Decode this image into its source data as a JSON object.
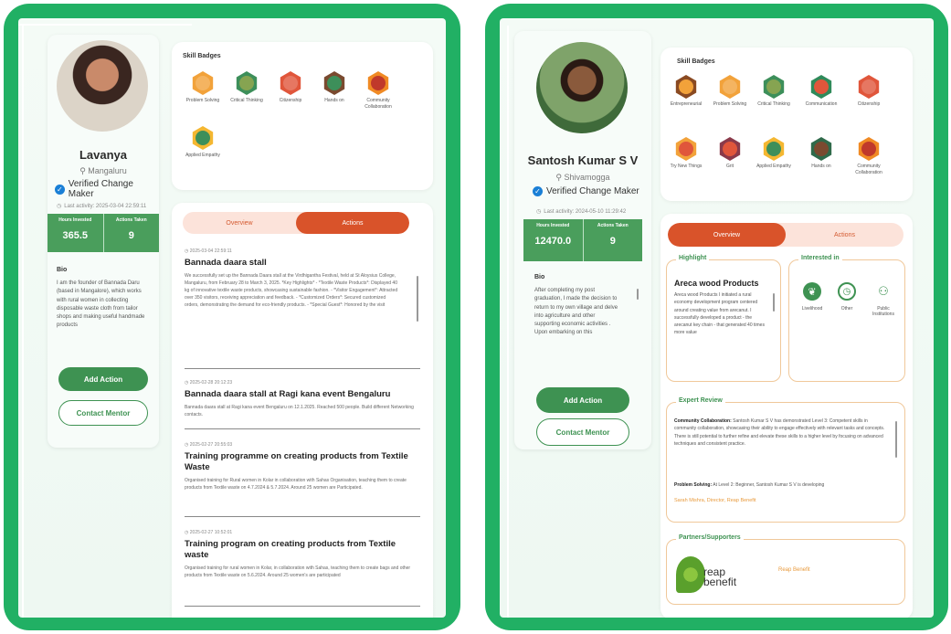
{
  "left": {
    "name": "Lavanya",
    "location": "Mangaluru",
    "verified_label": "Verified Change Maker",
    "last_activity": "Last activity: 2025-03-04 22:59:11",
    "stats": [
      {
        "label": "Hours Invested",
        "value": "365.5"
      },
      {
        "label": "Actions Taken",
        "value": "9"
      }
    ],
    "bio_title": "Bio",
    "bio_text": "I am the founder of Bannada Daru (based in Mangalore), which works with rural women in collecting disposable waste cloth from tailor shops and making useful handmade products",
    "add_action": "Add Action",
    "contact_mentor": "Contact Mentor",
    "skill_badges_title": "Skill Badges",
    "badges": [
      {
        "label": "Problem Solving",
        "color": "#f2a23a",
        "icon": "puzzle-icon"
      },
      {
        "label": "Critical Thinking",
        "color": "#3d8f5a",
        "icon": "lightbulb-icon"
      },
      {
        "label": "Citizenship",
        "color": "#e0563b",
        "icon": "flag-icon"
      },
      {
        "label": "Hands on",
        "color": "#7a4a2f",
        "icon": "hand-icon"
      },
      {
        "label": "Community Collaboration",
        "color": "#f08a24",
        "icon": "handshake-icon"
      },
      {
        "label": "Applied Empathy",
        "color": "#f4b731",
        "icon": "heart-hands-icon"
      }
    ],
    "tabs": [
      {
        "label": "Overview"
      },
      {
        "label": "Actions"
      }
    ],
    "actions": [
      {
        "date": "2025-03-04 22:59:11",
        "title": "Bannada daara stall",
        "desc": "We successfully set up the Bannada Daara stall at the Virdhigantha Festival, held at St Aloysius College, Mangaluru, from February 28 to March 3, 2025. *Key Highlights* - *Textile Waste Products*: Displayed 40 kg of innovative textile waste products, showcasing sustainable fashion. - *Visitor Engagement*: Attracted over 350 visitors, receiving appreciation and feedback. - *Customized Orders*: Secured customized orders, demonstrating the demand for eco-friendly products. - *Special Guest*: Honored by the visit"
      },
      {
        "date": "2025-02-28 20:12:23",
        "title": "Bannada daara stall at Ragi kana event Bengaluru",
        "desc": "Bannada daara stall at Ragi kana event Bengaluru on 12.1.2025. Reached 500 people. Build different Networking contacts."
      },
      {
        "date": "2025-02-27 20:55:03",
        "title": "Training programme on creating products from Textile Waste",
        "desc": "Organised training for Rural women in Kolar in collaboration with Sahas Organisation, teaching them to create products from Textile waste on 4.7.2024 & 5.7.2024. Around 25 women are Participated."
      },
      {
        "date": "2025-02-27 10:52:01",
        "title": "Training program on creating products from Textile waste",
        "desc": "Organised training for rural women in Kolar, in collaboration with Sahas, teaching them to create bags and other products from Textile waste on 5.6.2024. Around 25 women's are participated"
      }
    ]
  },
  "right": {
    "name": "Santosh Kumar S V",
    "location": "Shivamogga",
    "verified_label": "Verified Change Maker",
    "last_activity": "Last activity: 2024-05-10 11:29:42",
    "stats": [
      {
        "label": "Hours Invested",
        "value": "12470.0"
      },
      {
        "label": "Actions Taken",
        "value": "9"
      }
    ],
    "bio_title": "Bio",
    "bio_text": "After completing my post graduation, I made the decision to return to my own village and delve into agriculture and other supporting economic activities . Upon embarking on this",
    "add_action": "Add Action",
    "contact_mentor": "Contact Mentor",
    "skill_badges_title": "Skill Badges",
    "badges": [
      {
        "label": "Entrepreneurial",
        "color": "#8a4a22",
        "icon": "gear-icon"
      },
      {
        "label": "Problem Solving",
        "color": "#f2a23a",
        "icon": "puzzle-icon"
      },
      {
        "label": "Critical Thinking",
        "color": "#3d8f5a",
        "icon": "lightbulb-icon"
      },
      {
        "label": "Communication",
        "color": "#2f8a5a",
        "icon": "chat-icon"
      },
      {
        "label": "Citizenship",
        "color": "#e0563b",
        "icon": "flag-icon"
      },
      {
        "label": "Try New Things",
        "color": "#f2a23a",
        "icon": "sparkle-icon"
      },
      {
        "label": "Grit",
        "color": "#8a3a4a",
        "icon": "fist-icon"
      },
      {
        "label": "Applied Empathy",
        "color": "#f4b731",
        "icon": "heart-hands-icon"
      },
      {
        "label": "Hands on",
        "color": "#2f6a4a",
        "icon": "hand-icon"
      },
      {
        "label": "Community Collaboration",
        "color": "#f08a24",
        "icon": "handshake-icon"
      }
    ],
    "tabs": [
      {
        "label": "Overview"
      },
      {
        "label": "Actions"
      }
    ],
    "highlight": {
      "legend": "Highlight",
      "title": "Areca wood Products",
      "text": "Areca wood Products I initiated a rural economy development program centered around creating value from arecanut. I successfully developed a product - the arecanut key chain - that generated 40 times more value"
    },
    "interested": {
      "legend": "Interested in",
      "items": [
        {
          "label": "Livelihood",
          "icon": "leaf-icon"
        },
        {
          "label": "Other",
          "icon": "stopwatch-icon"
        },
        {
          "label": "Public Institutions",
          "icon": "people-icon"
        }
      ]
    },
    "expert_review": {
      "legend": "Expert Review",
      "p1_title": "Community Collaboration:",
      "p1_text": "Santosh Kumar S V has demonstrated Level 3: Competent skills in community collaboration, showcasing their ability to engage effectively with relevant tasks and concepts. There is still potential to further refine and elevate these skills to a higher level by focusing on advanced techniques and consistent practice.",
      "p2_title": "Problem Solving:",
      "p2_text": "At Level 2: Beginner, Santosh Kumar S V is developing",
      "reviewer": "Sarah Mishra, Director, Reap Benefit"
    },
    "partners": {
      "legend": "Partners/Supporters",
      "logo_text": "reap benefit",
      "name": "Reap Benefit"
    }
  }
}
